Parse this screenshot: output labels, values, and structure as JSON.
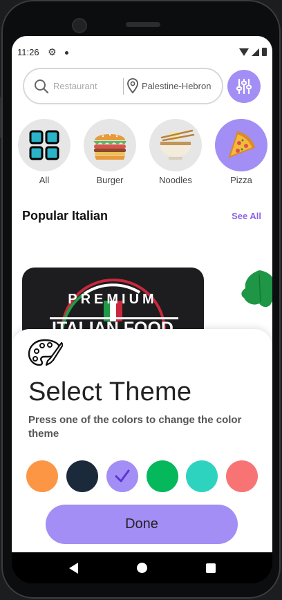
{
  "status_bar": {
    "time": "11:26"
  },
  "search": {
    "placeholder": "Restaurant",
    "location": "Palestine-Hebron"
  },
  "categories": [
    {
      "label": "All",
      "icon": "grid-icon"
    },
    {
      "label": "Burger",
      "icon": "burger-icon"
    },
    {
      "label": "Noodles",
      "icon": "noodles-icon"
    },
    {
      "label": "Pizza",
      "icon": "pizza-icon",
      "selected": true
    }
  ],
  "popular": {
    "title": "Popular Italian",
    "see_all": "See All",
    "promo_brand": "PREMIUM",
    "promo_text": "ITALIAN FOOD"
  },
  "theme_sheet": {
    "title": "Select Theme",
    "subtitle": "Press one of the colors to change the color theme",
    "swatches": [
      {
        "name": "orange",
        "color": "#fc9644"
      },
      {
        "name": "dark-navy",
        "color": "#1b2a3b"
      },
      {
        "name": "purple",
        "color": "#a38ef5",
        "selected": true
      },
      {
        "name": "green",
        "color": "#05b85c"
      },
      {
        "name": "teal",
        "color": "#2ed3c0"
      },
      {
        "name": "coral",
        "color": "#f87474"
      }
    ],
    "done_label": "Done"
  },
  "colors": {
    "accent": "#a38ef5",
    "link": "#8a63e8"
  }
}
